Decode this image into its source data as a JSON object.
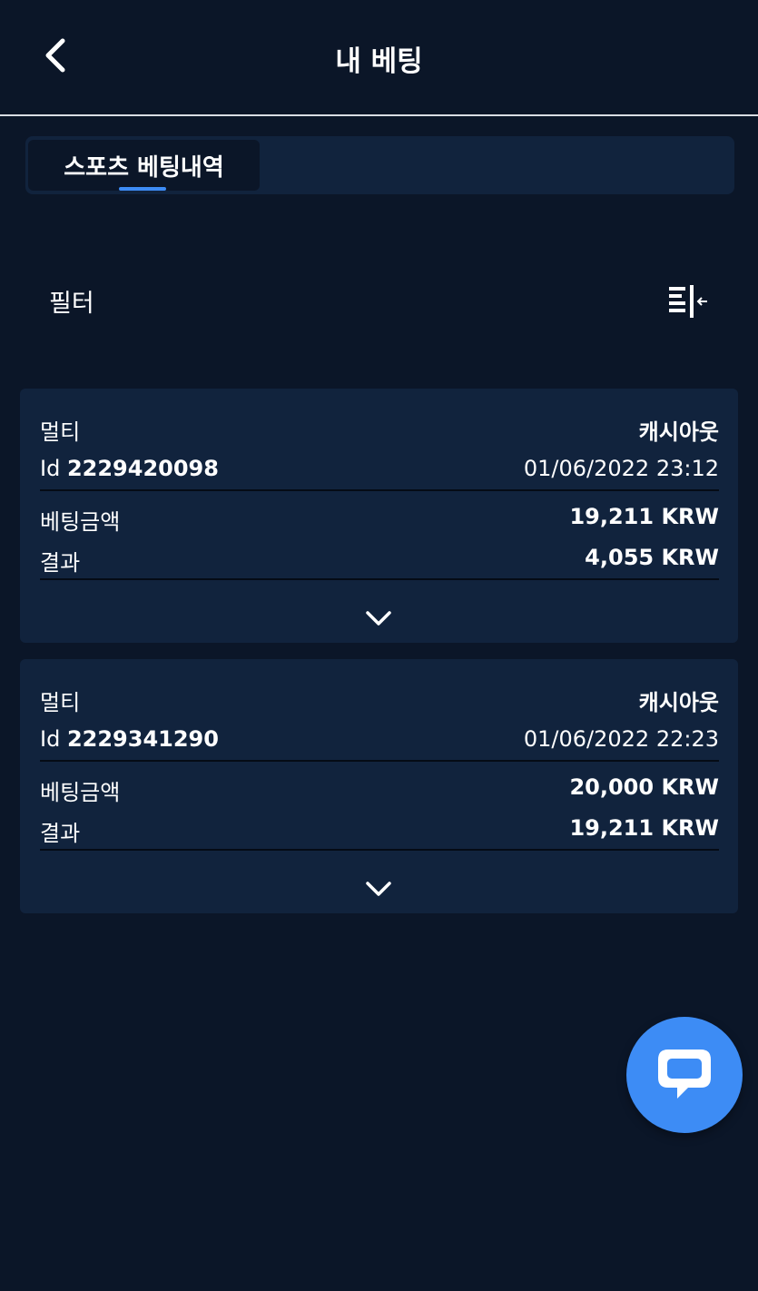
{
  "header": {
    "title": "내 베팅",
    "back_icon": "chevron-left-icon"
  },
  "tabs": [
    {
      "label": "스포츠 베팅내역",
      "active": true
    }
  ],
  "filter": {
    "label": "필터",
    "icon": "filter-collapse-icon"
  },
  "bets": [
    {
      "type": "멀티",
      "status": "캐시아웃",
      "id_label": "Id",
      "id": "2229420098",
      "datetime": "01/06/2022 23:12",
      "stake_label": "베팅금액",
      "stake": "19,211 KRW",
      "result_label": "결과",
      "result": "4,055 KRW"
    },
    {
      "type": "멀티",
      "status": "캐시아웃",
      "id_label": "Id",
      "id": "2229341290",
      "datetime": "01/06/2022 22:23",
      "stake_label": "베팅금액",
      "stake": "20,000 KRW",
      "result_label": "결과",
      "result": "19,211 KRW"
    }
  ],
  "chat": {
    "icon": "chat-bubble-icon"
  },
  "colors": {
    "background": "#0b1628",
    "card": "#11233d",
    "accent": "#3d8cf5"
  }
}
